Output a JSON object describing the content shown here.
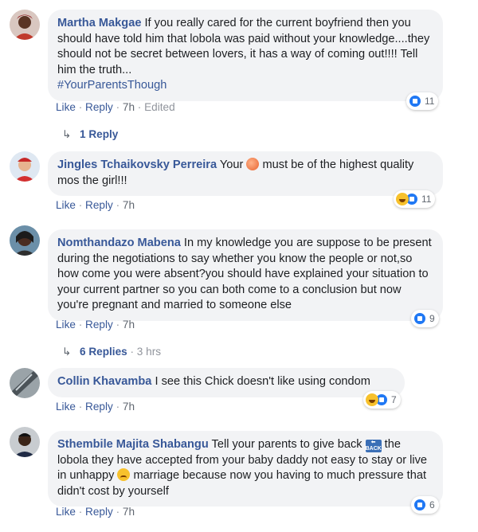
{
  "comments": [
    {
      "author": "Martha Makgae",
      "text": " If you really cared for the current boyfriend then you should have told him that lobola was paid without your knowledge....they should not be secret between lovers, it has a way of coming out!!!! Tell him the truth...",
      "hashtag": "#YourParentsThough",
      "like_label": "Like",
      "reply_label": "Reply",
      "time": "7h",
      "edited": "Edited",
      "reaction_count": "11",
      "replies_label": "1 Reply"
    },
    {
      "author": "Jingles Tchaikovsky Perreira",
      "text_before": " Your ",
      "text_after": " must be of the highest quality mos the girl!!!",
      "like_label": "Like",
      "reply_label": "Reply",
      "time": "7h",
      "reaction_count": "11"
    },
    {
      "author": "Nomthandazo Mabena",
      "text": " In my knowledge you are suppose to be present during the negotiations to say whether you know the people or not,so how come you were absent?you should have explained your situation to your current partner so you can both come to a conclusion but now you're pregnant and married to someone else",
      "like_label": "Like",
      "reply_label": "Reply",
      "time": "7h",
      "reaction_count": "9",
      "replies_label": "6 Replies",
      "replies_time": "3 hrs"
    },
    {
      "author": "Collin Khavamba",
      "text": " I see this Chick doesn't like using condom",
      "like_label": "Like",
      "reply_label": "Reply",
      "time": "7h",
      "reaction_count": "7"
    },
    {
      "author": "Sthembile Majita Shabangu",
      "text_before": " Tell your parents to give back ",
      "text_middle": " the lobola they have accepted from your baby daddy not easy to stay or live in unhappy ",
      "text_after": " marriage because now you having to much pressure that didn't cost by yourself",
      "like_label": "Like",
      "reply_label": "Reply",
      "time": "7h",
      "reaction_count": "6"
    }
  ],
  "separator": "·",
  "emoji_back_text": "BACK",
  "colors": {
    "link": "#385898",
    "bubble": "#f2f3f5",
    "like_blue": "#2078f4",
    "haha_yellow": "#f7c12c"
  }
}
